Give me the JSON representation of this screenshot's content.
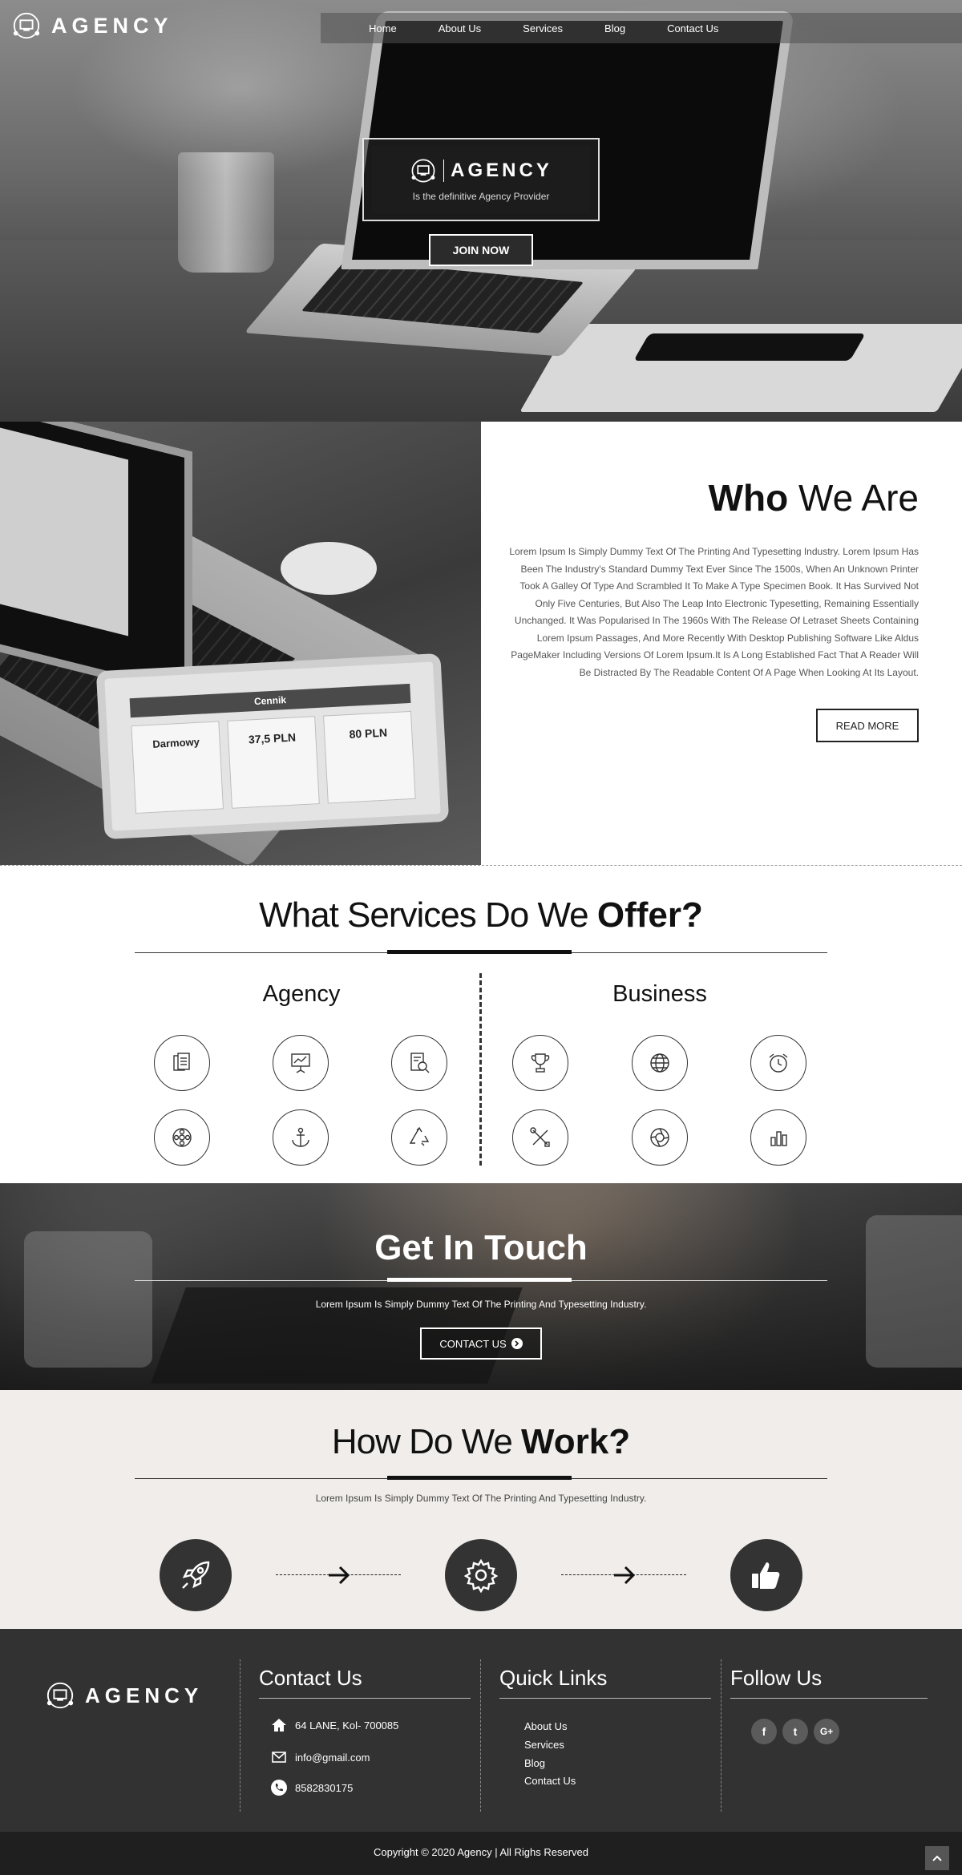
{
  "header": {
    "logo_text": "AGENCY",
    "nav": [
      "Home",
      "About Us",
      "Services",
      "Blog",
      "Contact Us"
    ]
  },
  "hero": {
    "brand_name": "AGENCY",
    "tagline": "Is the definitive  Agency Provider",
    "cta_label": "JOIN NOW"
  },
  "who": {
    "title_bold": "Who",
    "title_rest": " We Are",
    "paragraph": "Lorem Ipsum Is Simply Dummy Text Of The Printing And Typesetting Industry. Lorem Ipsum Has Been The Industry's Standard Dummy Text Ever Since The 1500s, When An Unknown Printer Took A Galley Of Type And Scrambled It To Make A Type Specimen Book. It Has Survived Not Only Five Centuries, But Also The Leap Into Electronic Typesetting, Remaining Essentially Unchanged. It Was Popularised In The 1960s With The Release Of Letraset Sheets Containing Lorem Ipsum Passages, And More Recently With Desktop Publishing Software Like Aldus PageMaker Including Versions Of Lorem Ipsum.It Is A Long Established Fact That A Reader Will Be Distracted By The Readable Content Of A Page When Looking At Its Layout.",
    "button_label": "READ MORE",
    "tablet_title": "Cennik",
    "tablet_price_1": "37,5 PLN",
    "tablet_price_2": "80 PLN",
    "tablet_plan": "Darmowy"
  },
  "services": {
    "title_rest": "What Services Do We ",
    "title_bold": "Offer?",
    "columns": [
      {
        "heading": "Agency",
        "icons": [
          "documents-icon",
          "presentation-chart-icon",
          "document-search-icon",
          "film-reel-icon",
          "anchor-icon",
          "recycle-icon"
        ]
      },
      {
        "heading": "Business",
        "icons": [
          "trophy-icon",
          "globe-icon",
          "alarm-clock-icon",
          "tools-icon",
          "aperture-icon",
          "bar-chart-icon"
        ]
      }
    ]
  },
  "touch": {
    "title_rest": "Get In ",
    "title_bold": "Touch",
    "subtitle": "Lorem Ipsum Is Simply Dummy Text Of The Printing And Typesetting Industry.",
    "button_label": "CONTACT US"
  },
  "work": {
    "title_rest": "How Do We ",
    "title_bold": "Work?",
    "subtitle": "Lorem Ipsum Is Simply Dummy Text Of The Printing And Typesetting Industry.",
    "steps": [
      "rocket-icon",
      "gear-icon",
      "thumbs-up-icon"
    ]
  },
  "footer": {
    "logo_text": "AGENCY",
    "contact_heading": "Contact Us",
    "address": "64 LANE, Kol- 700085",
    "email": "info@gmail.com",
    "phone": "8582830175",
    "links_heading": "Quick Links",
    "links": [
      "About Us",
      "Services",
      "Blog",
      "Contact Us"
    ],
    "follow_heading": "Follow Us",
    "social": [
      "f",
      "t",
      "G+"
    ],
    "copyright": "Copyright © 2020 Agency | All Righs Reserved"
  }
}
